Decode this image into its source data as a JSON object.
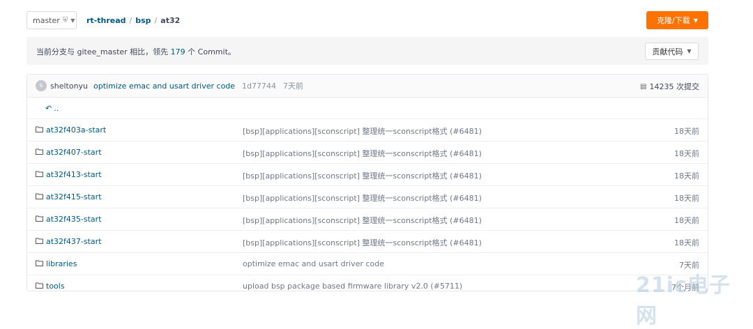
{
  "header": {
    "branch": "master",
    "breadcrumb": [
      "rt-thread",
      "bsp",
      "at32"
    ],
    "breadcrumb_sep": "/",
    "clone_button": "克隆/下载"
  },
  "compare": {
    "prefix": "当前分支与 gitee_master 相比，领先",
    "count": "179",
    "suffix": "个 Commit。",
    "contribute_button": "贡献代码"
  },
  "last_commit": {
    "avatar_letter": "s",
    "author": "sheltonyu",
    "message": "optimize emac and usart driver code",
    "sha": "1d77744",
    "ago": "7天前",
    "total_commits": "14235 次提交"
  },
  "parent_link": "..",
  "files": [
    {
      "name": "at32f403a-start",
      "message": "[bsp][applications][sconscript] 整理统一sconscript格式 (#6481)",
      "date": "18天前"
    },
    {
      "name": "at32f407-start",
      "message": "[bsp][applications][sconscript] 整理统一sconscript格式 (#6481)",
      "date": "18天前"
    },
    {
      "name": "at32f413-start",
      "message": "[bsp][applications][sconscript] 整理统一sconscript格式 (#6481)",
      "date": "18天前"
    },
    {
      "name": "at32f415-start",
      "message": "[bsp][applications][sconscript] 整理统一sconscript格式 (#6481)",
      "date": "18天前"
    },
    {
      "name": "at32f435-start",
      "message": "[bsp][applications][sconscript] 整理统一sconscript格式 (#6481)",
      "date": "18天前"
    },
    {
      "name": "at32f437-start",
      "message": "[bsp][applications][sconscript] 整理统一sconscript格式 (#6481)",
      "date": "18天前"
    },
    {
      "name": "libraries",
      "message": "optimize emac and usart driver code",
      "date": "7天前"
    },
    {
      "name": "tools",
      "message": "upload bsp package based firmware library v2.0 (#5711)",
      "date": "7个月前"
    }
  ],
  "watermark": "21ic电子网",
  "colors": {
    "accent": "#fe7300",
    "link": "#005980"
  }
}
